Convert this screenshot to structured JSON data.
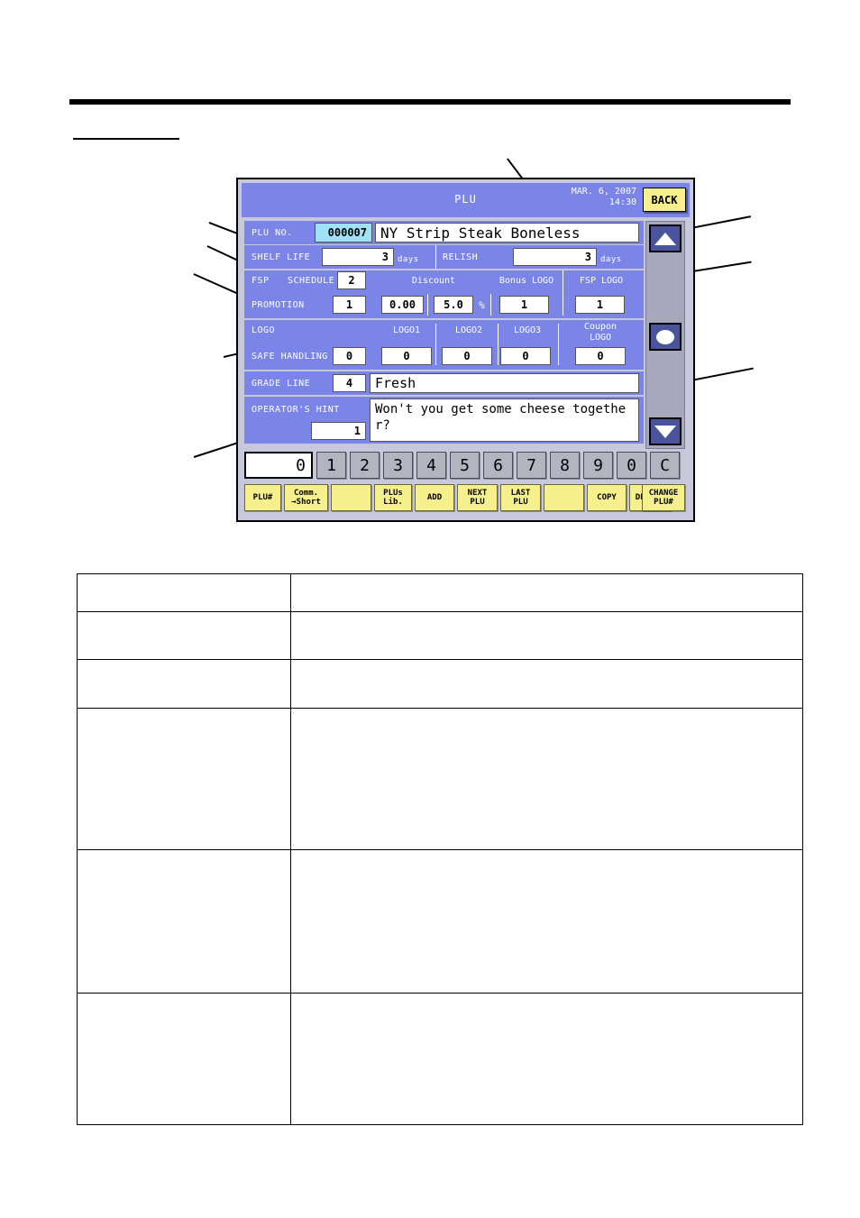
{
  "device": {
    "titlebar": {
      "title": "PLU",
      "date": "MAR. 6, 2007",
      "time": "14:30",
      "back_label": "BACK"
    },
    "fields": {
      "plu_no_label": "PLU NO.",
      "plu_no_value": "000007",
      "plu_name_value": "NY Strip Steak Boneless",
      "shelf_life_label": "SHELF LIFE",
      "shelf_life_value": "3",
      "shelf_life_unit": "days",
      "relish_label": "RELISH",
      "relish_value": "3",
      "relish_unit": "days",
      "fsp_schedule_label_a": "FSP",
      "fsp_schedule_label_b": "SCHEDULE",
      "fsp_schedule_value": "2",
      "promotion_label": "PROMOTION",
      "promotion_value": "1",
      "discount_label": "Discount",
      "discount_amount": "0.00",
      "discount_percent": "5.0",
      "percent_sign": "%",
      "bonus_logo_label": "Bonus LOGO",
      "bonus_logo_value": "1",
      "fsp_logo_label": "FSP LOGO",
      "fsp_logo_value": "1",
      "logo_label": "LOGO",
      "logo1_label": "LOGO1",
      "logo1_value": "0",
      "logo2_label": "LOGO2",
      "logo2_value": "0",
      "logo3_label": "LOGO3",
      "logo3_value": "0",
      "coupon_logo_label_a": "Coupon",
      "coupon_logo_label_b": "LOGO",
      "coupon_logo_value": "0",
      "safe_handling_label": "SAFE HANDLING",
      "safe_handling_value": "0",
      "grade_line_label": "GRADE LINE",
      "grade_line_number": "4",
      "grade_line_text": "Fresh",
      "operators_hint_label": "OPERATOR'S HINT",
      "operators_hint_number": "1",
      "operators_hint_text": "Won't you get some cheese together?"
    },
    "scroll": {
      "up_icon": "triangle-up-icon",
      "page_icon": "circle-icon",
      "down_icon": "triangle-down-icon"
    },
    "keypad": {
      "display_value": "0",
      "keys": [
        "1",
        "2",
        "3",
        "4",
        "5",
        "6",
        "7",
        "8",
        "9",
        "0",
        "C"
      ]
    },
    "function_buttons": [
      {
        "line1": "PLU#",
        "line2": ""
      },
      {
        "line1": "Comm.",
        "line2": "→Short"
      },
      {
        "line1": "",
        "line2": ""
      },
      {
        "line1": "PLUs",
        "line2": "Lib."
      },
      {
        "line1": "ADD",
        "line2": ""
      },
      {
        "line1": "NEXT",
        "line2": "PLU"
      },
      {
        "line1": "LAST",
        "line2": "PLU"
      },
      {
        "line1": "",
        "line2": ""
      },
      {
        "line1": "COPY",
        "line2": ""
      },
      {
        "line1": "DELETE",
        "line2": ""
      },
      {
        "line1": "CHANGE",
        "line2": "PLU#"
      }
    ],
    "colors": {
      "panel_blue": "#7b85e8",
      "bezel_gray": "#c8c8dc",
      "button_yellow": "#f5f08c",
      "key_gray": "#b4b4c0",
      "field_cyan": "#9fe2f5",
      "scroll_navy": "#4a549c"
    }
  },
  "description_table": {
    "rows": [
      {
        "term": "",
        "description": ""
      },
      {
        "term": "",
        "description": ""
      },
      {
        "term": "",
        "description": ""
      },
      {
        "term": "",
        "description": ""
      },
      {
        "term": "",
        "description": ""
      },
      {
        "term": "",
        "description": ""
      }
    ]
  }
}
